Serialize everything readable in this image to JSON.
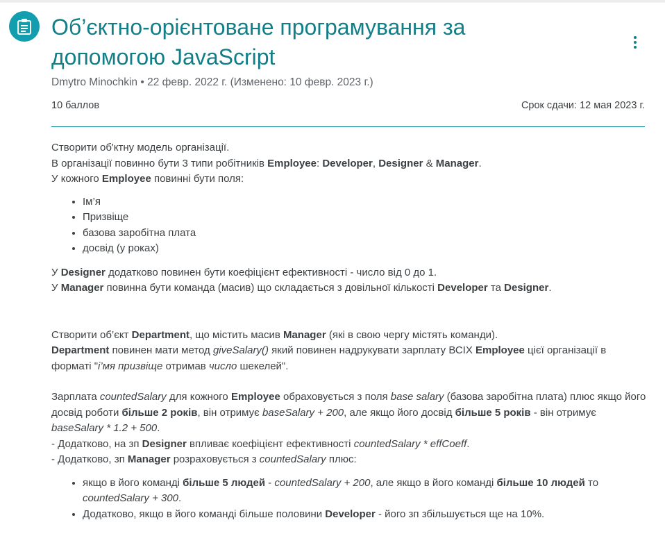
{
  "header": {
    "title_line1": "Об’єктно-орієнтоване програмування за",
    "title_line2": "допомогою JavaScript",
    "author": "Dmytro Minochkin",
    "date": "22 февр. 2022 г.",
    "edited": "(Изменено: 10 февр. 2023 г.)",
    "points": "10 баллов",
    "due": "Срок сдачи: 12 мая 2023 г.",
    "icon": "assignment-icon",
    "more_icon": "more-vert-icon",
    "accent_color": "#129eaf"
  },
  "body": {
    "p1": "Створити об'ктну модель організації.",
    "p2": {
      "a": "В організації повинно бути 3 типи робітників ",
      "b": "Employee",
      "c": ": ",
      "d": "Developer",
      "e": ", ",
      "f": "Designer",
      "g": " & ",
      "h": "Manager",
      "i": "."
    },
    "p3": {
      "a": "У кожного ",
      "b": "Employee",
      "c": " повинні бути поля:"
    },
    "fields": [
      "Ім’я",
      "Призвіще",
      "базова заробітна плата",
      "досвід (у роках)"
    ],
    "p4": {
      "a": "У ",
      "b": "Designer",
      "c": " додатково повинен бути коефіцієнт ефективності - число від 0 до 1."
    },
    "p5": {
      "a": "У ",
      "b": "Manager",
      "c": " повинна бути команда (масив) що складається з довільної кількості ",
      "d": "Developer",
      "e": " та ",
      "f": "Designer",
      "g": "."
    },
    "p6": {
      "a": "Створити об’єкт ",
      "b": "Department",
      "c": ", що містить масив ",
      "d": "Manager",
      "e": " (які в свою чергу містять команди)."
    },
    "p7": {
      "a": "Department",
      "b": " повинен мати метод ",
      "c": "giveSalary()",
      "d": " який повинен надрукувати зарплату ВСІХ ",
      "e": "Employee",
      "f": " цієї організації в форматі \"",
      "g": "і’мя призвіще",
      "h": " отримав ",
      "i": "число",
      "j": " шекелей\"."
    },
    "p8": {
      "a": "Зарплата ",
      "b": "countedSalary",
      "c": " для кожного ",
      "d": "Employee",
      "e": " обраховується з поля ",
      "f": "base salary",
      "g": " (базова заробітна плата) плюс якщо його досвід роботи ",
      "h": "більше 2 років",
      "i": ", він отримує ",
      "j": "baseSalary + 200",
      "k": ", але якщо його досвід ",
      "l": "більше 5 років",
      "m": " - він отримує ",
      "n": "baseSalary * 1.2 + 500",
      "o": "."
    },
    "p9": {
      "a": "- Додатково, на зп ",
      "b": "Designer",
      "c": " впливає коефіцієнт ефективності ",
      "d": "countedSalary * effCoeff",
      "e": "."
    },
    "p10": {
      "a": "- Додатково, зп ",
      "b": "Manager",
      "c": " розраховується з ",
      "d": "countedSalary",
      "e": " плюс:"
    },
    "li1": {
      "a": "якщо в його команді ",
      "b": "більше 5 людей",
      "c": " - ",
      "d": "countedSalary + 200",
      "e": ", але якщо в його команді ",
      "f": "більше 10 людей",
      "g": " то ",
      "h": "countedSalary + 300",
      "i": "."
    },
    "li2": {
      "a": "Додатково, якщо в його команді більше половини ",
      "b": "Developer",
      "c": " - його зп збільшується ще на 10%."
    }
  }
}
